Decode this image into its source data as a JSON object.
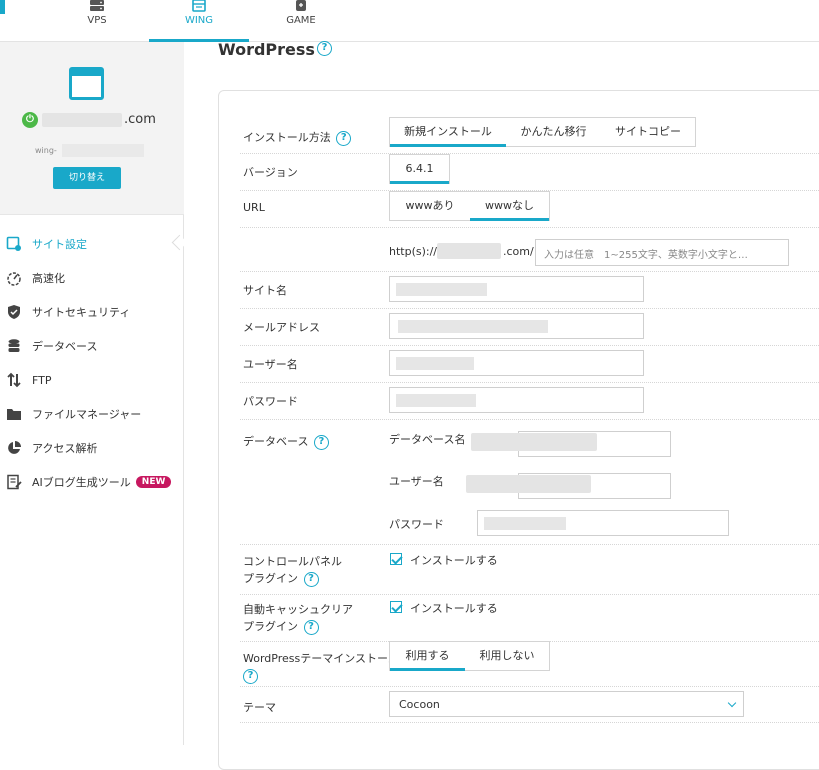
{
  "topnav": {
    "tabs": [
      {
        "label": "VPS",
        "icon": "server-icon"
      },
      {
        "label": "WING",
        "icon": "wing-icon"
      },
      {
        "label": "GAME",
        "icon": "gamepad-icon"
      }
    ],
    "active": "WING"
  },
  "sidebar": {
    "domain_suffix": ".com",
    "wing_prefix": "wing-",
    "switch_label": "切り替え",
    "items": [
      {
        "label": "サイト設定",
        "icon": "site-settings-icon",
        "active": true
      },
      {
        "label": "高速化",
        "icon": "speed-icon"
      },
      {
        "label": "サイトセキュリティ",
        "icon": "shield-icon"
      },
      {
        "label": "データベース",
        "icon": "database-icon"
      },
      {
        "label": "FTP",
        "icon": "ftp-icon"
      },
      {
        "label": "ファイルマネージャー",
        "icon": "folder-icon"
      },
      {
        "label": "アクセス解析",
        "icon": "pie-chart-icon"
      },
      {
        "label": "AIブログ生成ツール",
        "icon": "ai-blog-icon",
        "badge": "NEW"
      }
    ]
  },
  "main": {
    "title": "WordPress",
    "help_glyph": "?",
    "install_method": {
      "label": "インストール方法",
      "options": [
        "新規インストール",
        "かんたん移行",
        "サイトコピー"
      ],
      "selected": "新規インストール"
    },
    "version": {
      "label": "バージョン",
      "value": "6.4.1"
    },
    "url": {
      "label": "URL",
      "options": [
        "wwwあり",
        "wwwなし"
      ],
      "selected": "wwwなし",
      "prefix": "http(s)://",
      "suffix": ".com/",
      "placeholder": "入力は任意　1~255文字、英数字小文字と…"
    },
    "site_name": {
      "label": "サイト名"
    },
    "email": {
      "label": "メールアドレス"
    },
    "username": {
      "label": "ユーザー名"
    },
    "password": {
      "label": "パスワード"
    },
    "database": {
      "label": "データベース",
      "db_name_label": "データベース名",
      "user_label": "ユーザー名",
      "password_label": "パスワード"
    },
    "control_panel_plugin": {
      "label_line1": "コントロールパネル",
      "label_line2": "プラグイン",
      "check_label": "インストールする",
      "checked": true
    },
    "auto_cache_plugin": {
      "label_line1": "自動キャッシュクリア",
      "label_line2": "プラグイン",
      "check_label": "インストールする",
      "checked": true
    },
    "theme_install": {
      "label": "WordPressテーマインストール",
      "options": [
        "利用する",
        "利用しない"
      ],
      "selected": "利用する"
    },
    "theme": {
      "label": "テーマ",
      "value": "Cocoon"
    }
  },
  "colors": {
    "accent": "#19a8c9",
    "power_green": "#4cb848",
    "badge_new": "#c7175f"
  }
}
